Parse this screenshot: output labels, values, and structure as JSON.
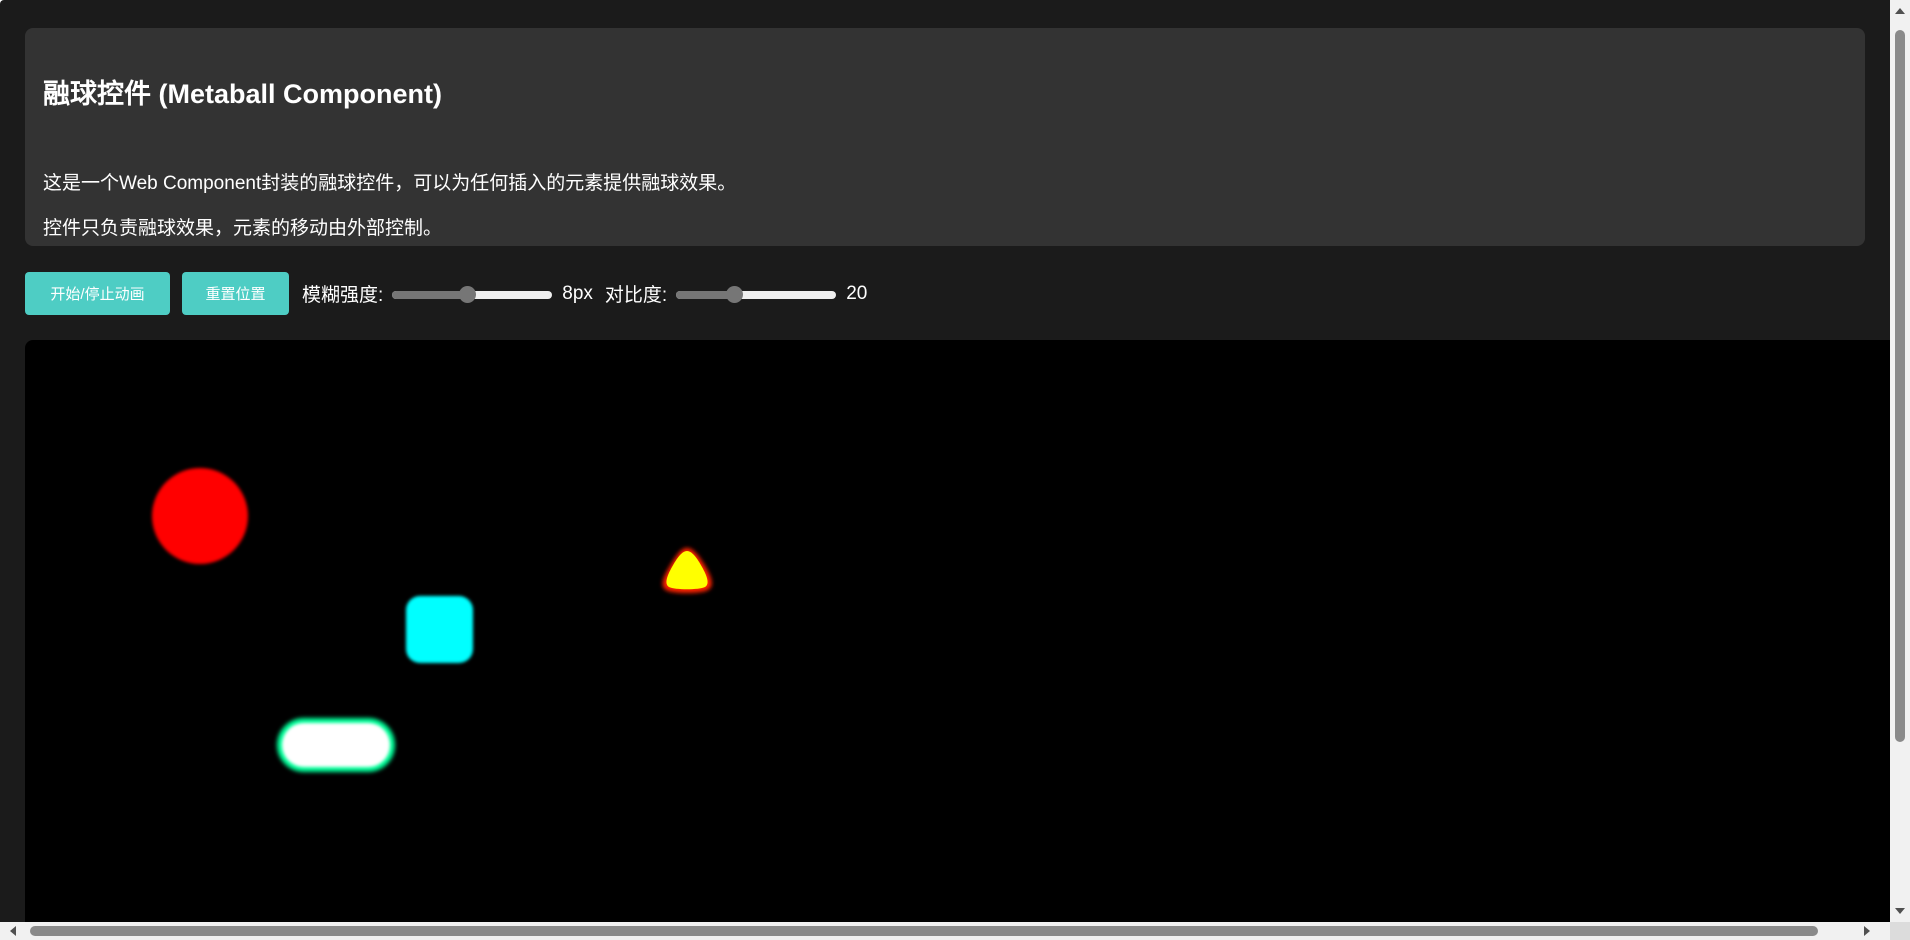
{
  "header": {
    "title": "融球控件 (Metaball Component)",
    "desc1": "这是一个Web Component封装的融球控件，可以为任何插入的元素提供融球效果。",
    "desc2": "控件只负责融球效果，元素的移动由外部控制。"
  },
  "controls": {
    "start_stop_label": "开始/停止动画",
    "reset_label": "重置位置",
    "blur_label": "模糊强度:",
    "blur_value": "8px",
    "blur_level_percent": 47,
    "contrast_label": "对比度:",
    "contrast_value": "20",
    "contrast_level_percent": 36
  },
  "colors": {
    "button": "#4ecdc4",
    "stage_bg": "#000000",
    "page_bg": "#1b1b1b",
    "card_bg": "#333333"
  },
  "balls": [
    {
      "name": "red-circle",
      "color": "#ff0000",
      "shape": "circle"
    },
    {
      "name": "cyan-rounded-square",
      "color": "#00ffff",
      "shape": "rounded-square"
    },
    {
      "name": "yellow-triangle",
      "color": "#ffff00",
      "shape": "triangle"
    },
    {
      "name": "white-green-pill",
      "color": "#ffffff",
      "shape": "pill"
    }
  ]
}
